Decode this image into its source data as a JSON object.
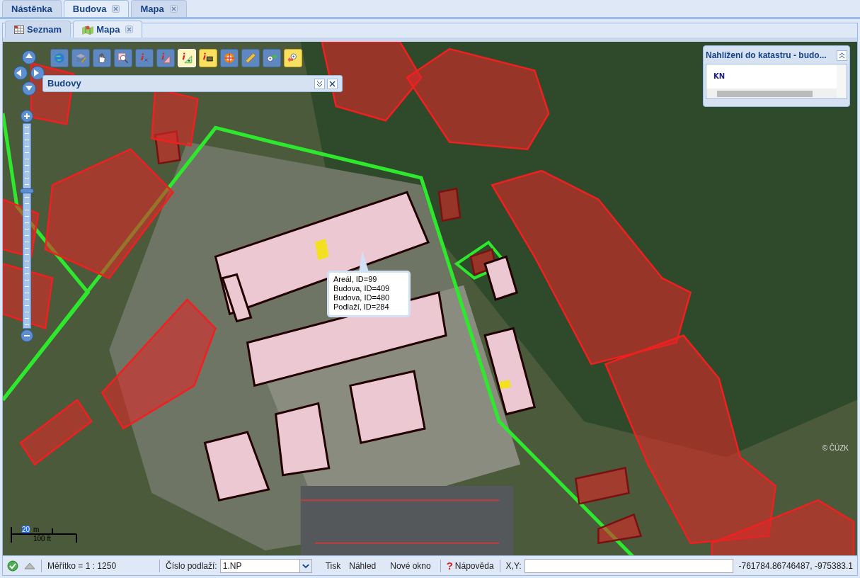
{
  "top_tabs": [
    {
      "label": "Nástěnka",
      "selected": false,
      "closable": false
    },
    {
      "label": "Budova",
      "selected": true,
      "closable": true
    },
    {
      "label": "Mapa",
      "selected": false,
      "closable": true
    }
  ],
  "sub_tabs": [
    {
      "label": "Seznam",
      "selected": false,
      "closable": false,
      "kind": "grid"
    },
    {
      "label": "Mapa",
      "selected": true,
      "closable": true,
      "kind": "map"
    }
  ],
  "map": {
    "tools": [
      {
        "kind": "globe",
        "selected": false
      },
      {
        "kind": "layers",
        "selected": false
      },
      {
        "kind": "hand",
        "selected": false
      },
      {
        "kind": "zoombox",
        "selected": false
      },
      {
        "kind": "info-point",
        "selected": false
      },
      {
        "kind": "info-area",
        "selected": false
      },
      {
        "kind": "info-add",
        "selected": true
      },
      {
        "kind": "info-note",
        "selected": false
      },
      {
        "kind": "color",
        "selected": false
      },
      {
        "kind": "ruler",
        "selected": false
      },
      {
        "kind": "zoom-next",
        "selected": false
      },
      {
        "kind": "zoom-prev",
        "selected": false
      }
    ],
    "zoom": {
      "level": 0.67
    },
    "layer_panel": {
      "title": "Budovy"
    },
    "cadastre_panel": {
      "title": "Nahlížení do katastru - budo...",
      "logo": "KN"
    },
    "popup": {
      "lines": [
        "Areál, ID=99",
        "Budova, ID=409",
        "Budova, ID=480",
        "Podlaží, ID=284"
      ]
    },
    "scale": {
      "metric": "20",
      "metric_unit": "m",
      "imperial": "100 ft"
    },
    "copyright": "© ČÚZK"
  },
  "status_bar": {
    "scale": "Měřítko = 1 : 1250",
    "floor_label": "Číslo podlaží:",
    "floor_value": "1.NP",
    "buttons": [
      "Tisk",
      "Náhled",
      "Nové okno"
    ],
    "help_icon": "?",
    "help": "Nápověda",
    "xy_label": "X,Y:",
    "coordinates": "-761784.86746487, -975383.1"
  }
}
